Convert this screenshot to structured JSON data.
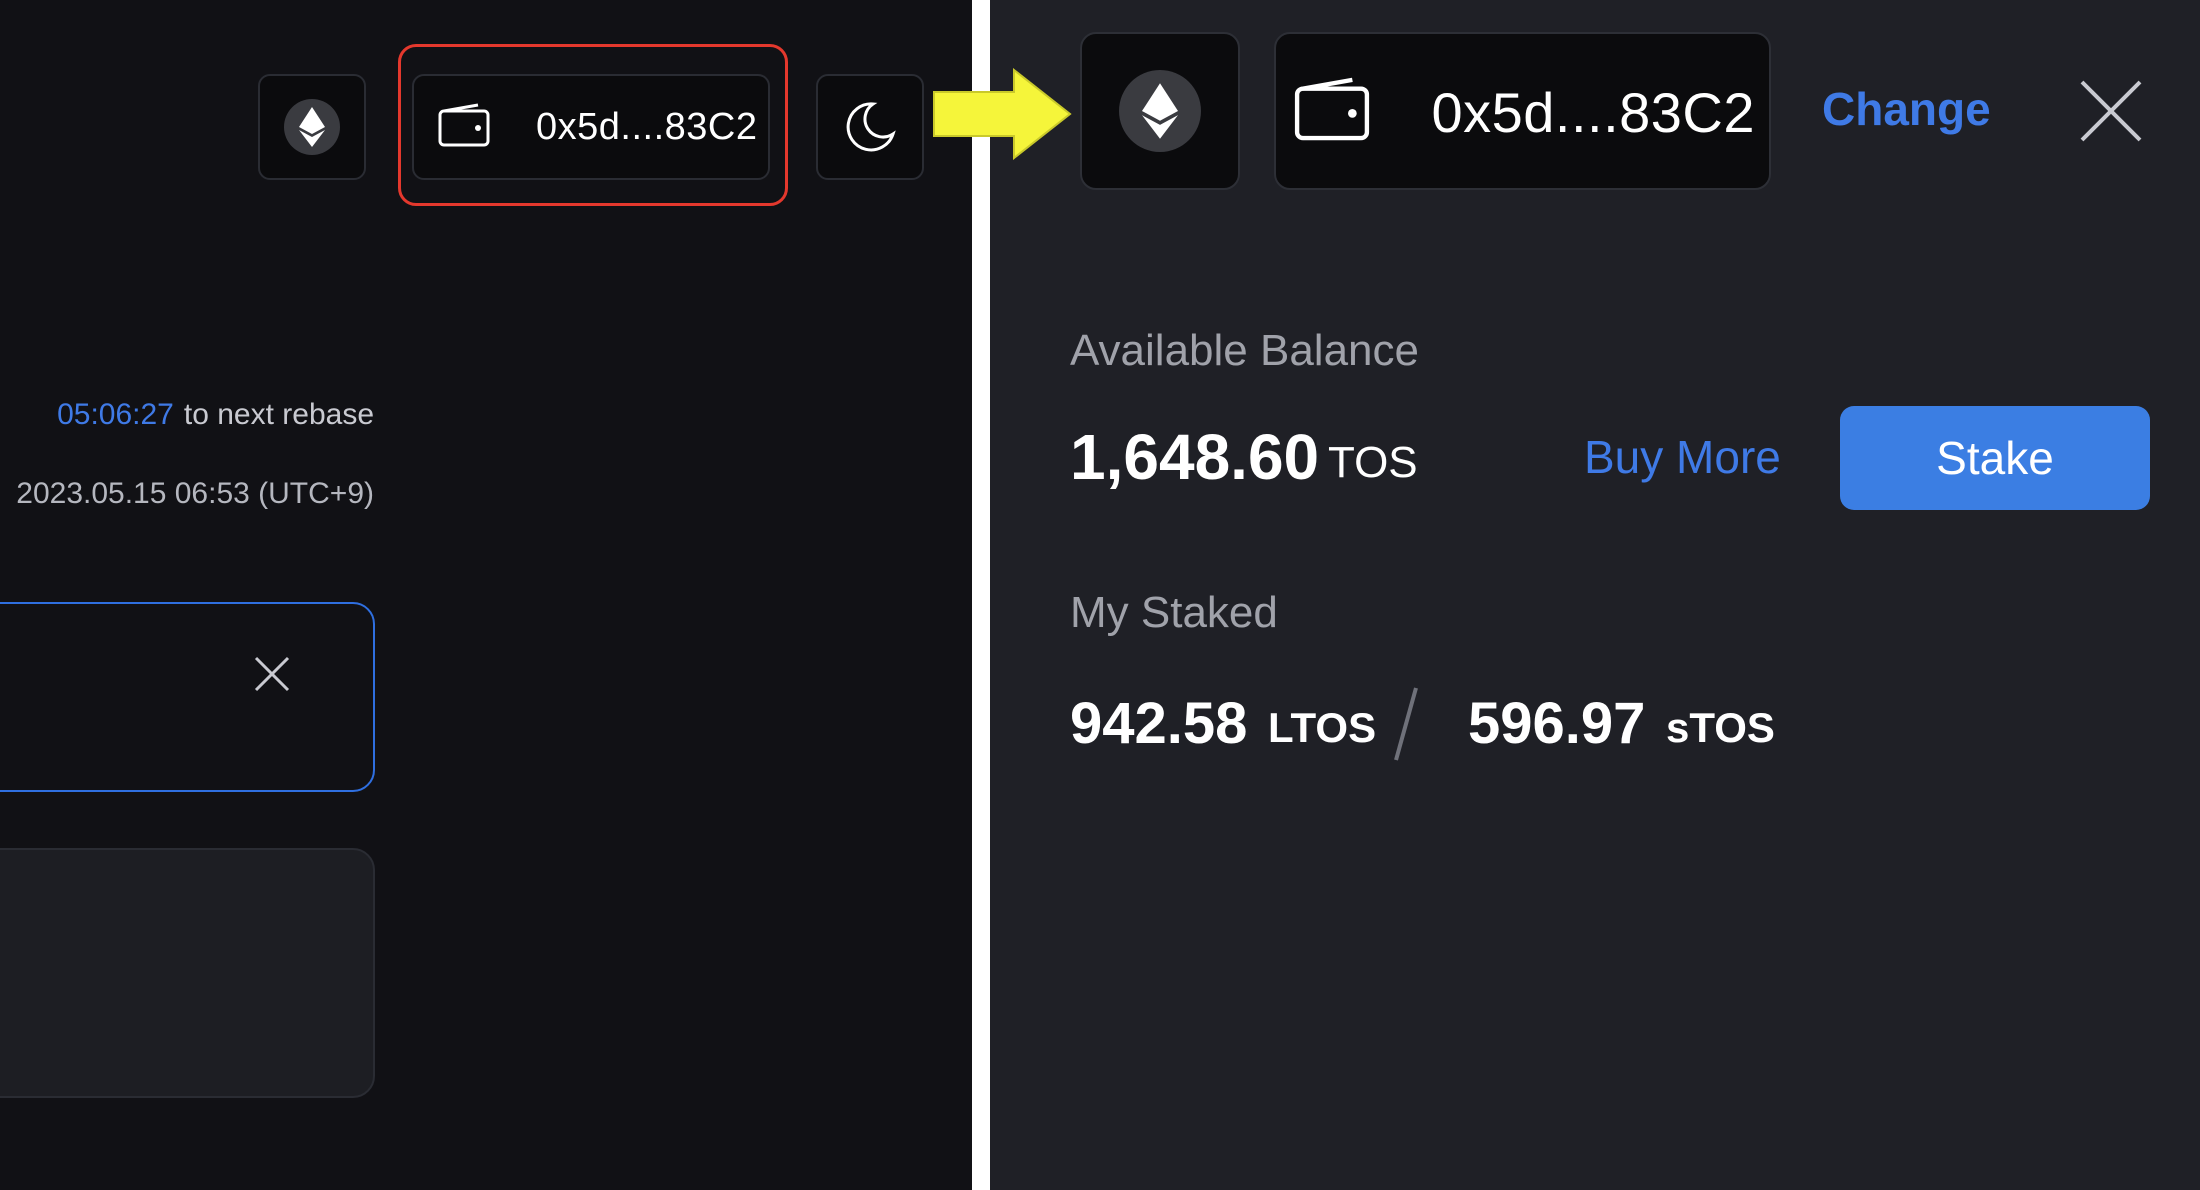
{
  "left": {
    "wallet_address": "0x5d....83C2",
    "rebase_countdown": "05:06:27",
    "rebase_suffix": "to next rebase",
    "rebase_date": "2023.05.15 06:53 (UTC+9)"
  },
  "right": {
    "wallet_address": "0x5d....83C2",
    "change_label": "Change",
    "available_balance_label": "Available Balance",
    "available_balance_value": "1,648.60",
    "available_balance_unit": "TOS",
    "buy_more_label": "Buy More",
    "stake_label": "Stake",
    "my_staked_label": "My Staked",
    "ltos_value": "942.58",
    "ltos_unit": "LTOS",
    "stos_value": "596.97",
    "stos_unit": "sTOS"
  },
  "colors": {
    "accent_blue": "#3f7ae6",
    "stake_button": "#3b7ee3",
    "highlight_red": "#e4382d",
    "arrow_yellow": "#f5f53a",
    "left_bg": "#111115",
    "right_bg": "#1f2026"
  },
  "icons": [
    "ethereum-icon",
    "wallet-icon",
    "moon-icon",
    "close-icon",
    "arrow-right-icon"
  ]
}
